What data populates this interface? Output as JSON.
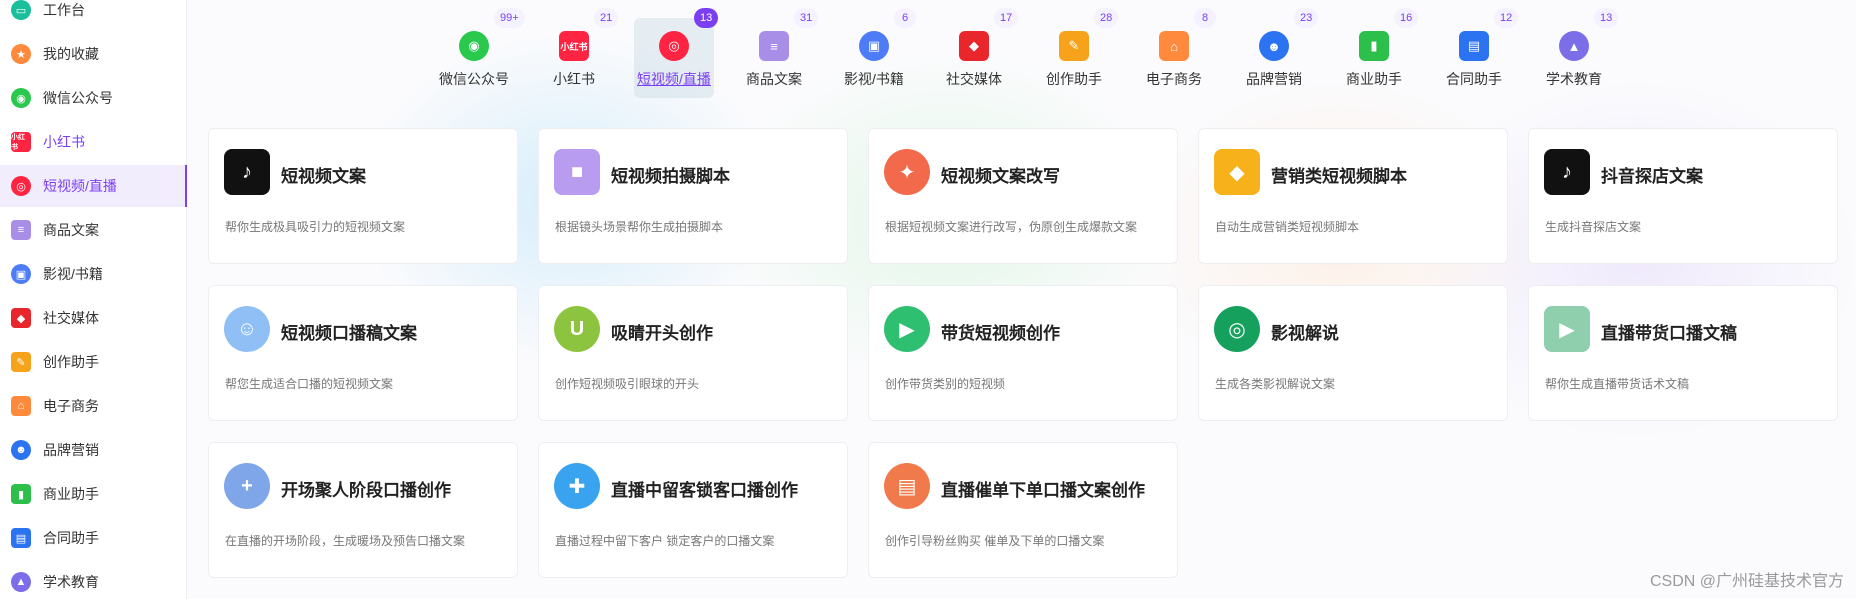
{
  "sidebar": {
    "items": [
      {
        "label": "工作台",
        "icon": "desktop-icon",
        "color": "#19be9b"
      },
      {
        "label": "我的收藏",
        "icon": "star-icon",
        "color": "#ff8a3d"
      },
      {
        "label": "微信公众号",
        "icon": "wechat-icon",
        "color": "#2bc84e"
      },
      {
        "label": "小红书",
        "icon": "xiaohongshu-icon",
        "color": "#ff2442"
      },
      {
        "label": "短视频/直播",
        "icon": "film-reel-icon",
        "color": "#ff2442"
      },
      {
        "label": "商品文案",
        "icon": "product-box-icon",
        "color": "#a98ee8"
      },
      {
        "label": "影视/书籍",
        "icon": "tv-icon",
        "color": "#4d7cf6"
      },
      {
        "label": "社交媒体",
        "icon": "cube-icon",
        "color": "#e8262b"
      },
      {
        "label": "创作助手",
        "icon": "pen-note-icon",
        "color": "#f7a21b"
      },
      {
        "label": "电子商务",
        "icon": "shop-icon",
        "color": "#ff8a3d"
      },
      {
        "label": "品牌营销",
        "icon": "people-icon",
        "color": "#2b73f0"
      },
      {
        "label": "商业助手",
        "icon": "bar-chart-icon",
        "color": "#2cbf4a"
      },
      {
        "label": "合同助手",
        "icon": "contract-icon",
        "color": "#2b73f0"
      },
      {
        "label": "学术教育",
        "icon": "graduation-cap-icon",
        "color": "#7b6ee8"
      }
    ]
  },
  "categories": [
    {
      "label": "微信公众号",
      "badge": "99+",
      "icon": "wechat-icon",
      "color": "#2bc84e",
      "glyph": "◉"
    },
    {
      "label": "小红书",
      "badge": "21",
      "icon": "xiaohongshu-icon",
      "color": "#ff2442",
      "glyph": "小红书"
    },
    {
      "label": "短视频/直播",
      "badge": "13",
      "icon": "film-reel-icon",
      "color": "#ff2442",
      "glyph": "◎"
    },
    {
      "label": "商品文案",
      "badge": "31",
      "icon": "product-box-icon",
      "color": "#a98ee8",
      "glyph": "≡"
    },
    {
      "label": "影视/书籍",
      "badge": "6",
      "icon": "tv-icon",
      "color": "#4d7cf6",
      "glyph": "▣"
    },
    {
      "label": "社交媒体",
      "badge": "17",
      "icon": "cube-icon",
      "color": "#e8262b",
      "glyph": "◆"
    },
    {
      "label": "创作助手",
      "badge": "28",
      "icon": "pen-note-icon",
      "color": "#f7a21b",
      "glyph": "✎"
    },
    {
      "label": "电子商务",
      "badge": "8",
      "icon": "shop-icon",
      "color": "#ff8a3d",
      "glyph": "⌂"
    },
    {
      "label": "品牌营销",
      "badge": "23",
      "icon": "people-icon",
      "color": "#2b73f0",
      "glyph": "☻"
    },
    {
      "label": "商业助手",
      "badge": "16",
      "icon": "bar-chart-icon",
      "color": "#2cbf4a",
      "glyph": "▮"
    },
    {
      "label": "合同助手",
      "badge": "12",
      "icon": "contract-icon",
      "color": "#2b73f0",
      "glyph": "▤"
    },
    {
      "label": "学术教育",
      "badge": "13",
      "icon": "graduation-cap-icon",
      "color": "#7b6ee8",
      "glyph": "▲"
    }
  ],
  "cards": [
    {
      "title": "短视频文案",
      "desc": "帮你生成极具吸引力的短视频文案",
      "icon": "tiktok-icon",
      "color": "#111111",
      "glyph": "♪"
    },
    {
      "title": "短视频拍摄脚本",
      "desc": "根据镜头场景帮你生成拍摄脚本",
      "icon": "video-camera-icon",
      "color": "#b89cf0",
      "glyph": "■"
    },
    {
      "title": "短视频文案改写",
      "desc": "根据短视频文案进行改写，伪原创生成爆款文案",
      "icon": "flame-icon",
      "color": "#f26a4b",
      "glyph": "✦"
    },
    {
      "title": "营销类短视频脚本",
      "desc": "自动生成营销类短视频脚本",
      "icon": "diamond-icon",
      "color": "#f7b21b",
      "glyph": "◆"
    },
    {
      "title": "抖音探店文案",
      "desc": "生成抖音探店文案",
      "icon": "tiktok-icon",
      "color": "#111111",
      "glyph": "♪"
    },
    {
      "title": "短视频口播稿文案",
      "desc": "帮您生成适合口播的短视频文案",
      "icon": "avatar-boy-icon",
      "color": "#8fbff5",
      "glyph": "☺"
    },
    {
      "title": "吸睛开头创作",
      "desc": "创作短视频吸引眼球的开头",
      "icon": "magnet-icon",
      "color": "#8cc43f",
      "glyph": "U"
    },
    {
      "title": "带货短视频创作",
      "desc": "创作带货类别的短视频",
      "icon": "shopping-bag-icon",
      "color": "#2fbf71",
      "glyph": "▶"
    },
    {
      "title": "影视解说",
      "desc": "生成各类影视解说文案",
      "icon": "film-reel-icon",
      "color": "#16a05d",
      "glyph": "◎"
    },
    {
      "title": "直播带货口播文稿",
      "desc": "帮你生成直播带货话术文稿",
      "icon": "clapperboard-icon",
      "color": "#8fcfae",
      "glyph": "▶"
    },
    {
      "title": "开场聚人阶段口播创作",
      "desc": "在直播的开场阶段，生成暖场及预告口播文案",
      "icon": "add-user-icon",
      "color": "#7ea6e8",
      "glyph": "+"
    },
    {
      "title": "直播中留客锁客口播创作",
      "desc": "直播过程中留下客户 锁定客户的口播文案",
      "icon": "chat-bubble-plus-icon",
      "color": "#3aa3f0",
      "glyph": "✚"
    },
    {
      "title": "直播催单下单口播文案创作",
      "desc": "创作引导粉丝购买 催单及下单的口播文案",
      "icon": "bag-icon",
      "color": "#f07a4b",
      "glyph": "▤"
    }
  ],
  "watermark": "CSDN @广州硅基技术官方"
}
